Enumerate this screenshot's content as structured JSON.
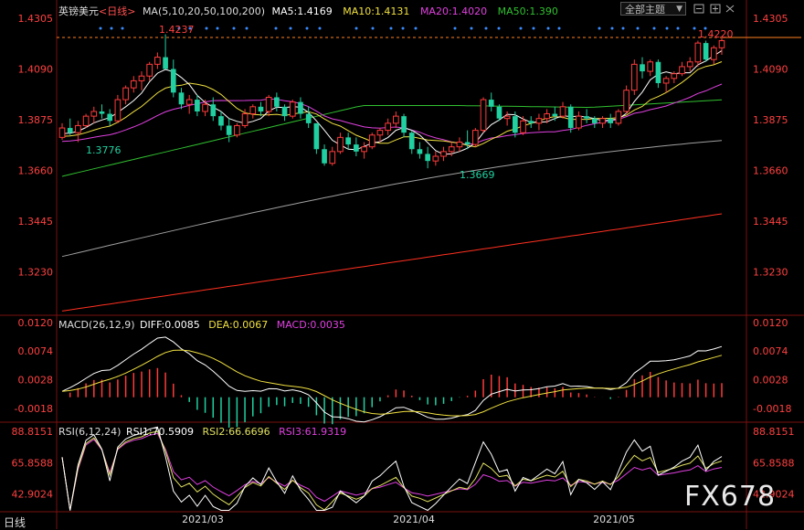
{
  "header": {
    "symbol": "英镑美元",
    "period": "<日线>",
    "ma_label": "MA(5,10,20,50,100,200)",
    "ma5": "MA5:1.4169",
    "ma10": "MA10:1.4131",
    "ma20": "MA20:1.4020",
    "ma50": "MA50:1.390",
    "theme_button": "全部主题",
    "period_tab": "日线"
  },
  "watermark": "FX678",
  "colors": {
    "up": "#ff3b3b",
    "down": "#20d0a0",
    "ma5": "#ffffff",
    "ma10": "#f0e040",
    "ma20": "#e040e0",
    "ma50": "#30c030",
    "ma100": "#a0a0a0",
    "ma200": "#ff3020",
    "price_axis": "#ff4040",
    "macd_axis": "#ff4040",
    "rsi1": "#ffffff",
    "rsi2": "#e0e060",
    "rsi3": "#e040e0"
  },
  "chart_data": [
    {
      "type": "candlestick",
      "title": "英镑美元<日线>",
      "ylim": [
        1.3046,
        1.4305
      ],
      "y_ticks": [
        "1.4305",
        "1.4090",
        "1.3875",
        "1.3660",
        "1.3445",
        "1.3230"
      ],
      "x_ticks": [
        "2021/03",
        "2021/04",
        "2021/05"
      ],
      "annotations": {
        "high": "1.4237",
        "low1": "1.3776",
        "low2": "1.3669",
        "last_high": "1.4220",
        "ma5": "1.4169",
        "ma10": "1.4131",
        "ma20": "1.4020",
        "ma50": "1.390"
      },
      "ohlc": [
        [
          1.38,
          1.386,
          1.379,
          1.384
        ],
        [
          1.384,
          1.388,
          1.381,
          1.382
        ],
        [
          1.382,
          1.387,
          1.378,
          1.385
        ],
        [
          1.385,
          1.39,
          1.384,
          1.389
        ],
        [
          1.389,
          1.393,
          1.386,
          1.391
        ],
        [
          1.391,
          1.394,
          1.388,
          1.39
        ],
        [
          1.39,
          1.392,
          1.385,
          1.387
        ],
        [
          1.387,
          1.398,
          1.386,
          1.396
        ],
        [
          1.396,
          1.402,
          1.394,
          1.401
        ],
        [
          1.401,
          1.406,
          1.399,
          1.404
        ],
        [
          1.404,
          1.408,
          1.4,
          1.406
        ],
        [
          1.406,
          1.412,
          1.404,
          1.411
        ],
        [
          1.411,
          1.416,
          1.409,
          1.414
        ],
        [
          1.414,
          1.4237,
          1.41,
          1.409
        ],
        [
          1.409,
          1.413,
          1.397,
          1.399
        ],
        [
          1.399,
          1.401,
          1.392,
          1.394
        ],
        [
          1.394,
          1.398,
          1.39,
          1.396
        ],
        [
          1.396,
          1.398,
          1.389,
          1.391
        ],
        [
          1.391,
          1.396,
          1.389,
          1.394
        ],
        [
          1.394,
          1.397,
          1.387,
          1.389
        ],
        [
          1.389,
          1.391,
          1.383,
          1.385
        ],
        [
          1.385,
          1.388,
          1.378,
          1.381
        ],
        [
          1.381,
          1.386,
          1.38,
          1.385
        ],
        [
          1.385,
          1.392,
          1.384,
          1.39
        ],
        [
          1.39,
          1.394,
          1.388,
          1.393
        ],
        [
          1.393,
          1.395,
          1.389,
          1.391
        ],
        [
          1.391,
          1.398,
          1.389,
          1.397
        ],
        [
          1.397,
          1.399,
          1.391,
          1.393
        ],
        [
          1.393,
          1.394,
          1.387,
          1.389
        ],
        [
          1.389,
          1.396,
          1.388,
          1.395
        ],
        [
          1.395,
          1.397,
          1.388,
          1.39
        ],
        [
          1.39,
          1.393,
          1.384,
          1.386
        ],
        [
          1.386,
          1.386,
          1.373,
          1.375
        ],
        [
          1.375,
          1.377,
          1.368,
          1.369
        ],
        [
          1.369,
          1.376,
          1.368,
          1.374
        ],
        [
          1.374,
          1.382,
          1.373,
          1.38
        ],
        [
          1.38,
          1.382,
          1.375,
          1.377
        ],
        [
          1.377,
          1.38,
          1.372,
          1.374
        ],
        [
          1.374,
          1.378,
          1.371,
          1.376
        ],
        [
          1.376,
          1.382,
          1.375,
          1.381
        ],
        [
          1.381,
          1.384,
          1.378,
          1.383
        ],
        [
          1.383,
          1.388,
          1.381,
          1.386
        ],
        [
          1.386,
          1.391,
          1.384,
          1.389
        ],
        [
          1.389,
          1.39,
          1.38,
          1.382
        ],
        [
          1.382,
          1.383,
          1.373,
          1.375
        ],
        [
          1.375,
          1.378,
          1.371,
          1.373
        ],
        [
          1.373,
          1.376,
          1.3669,
          1.37
        ],
        [
          1.37,
          1.374,
          1.368,
          1.372
        ],
        [
          1.372,
          1.376,
          1.37,
          1.374
        ],
        [
          1.374,
          1.378,
          1.372,
          1.376
        ],
        [
          1.376,
          1.38,
          1.374,
          1.378
        ],
        [
          1.378,
          1.383,
          1.375,
          1.377
        ],
        [
          1.377,
          1.384,
          1.376,
          1.383
        ],
        [
          1.383,
          1.397,
          1.382,
          1.396
        ],
        [
          1.396,
          1.399,
          1.391,
          1.393
        ],
        [
          1.393,
          1.394,
          1.387,
          1.388
        ],
        [
          1.388,
          1.391,
          1.385,
          1.389
        ],
        [
          1.389,
          1.391,
          1.38,
          1.382
        ],
        [
          1.382,
          1.389,
          1.381,
          1.387
        ],
        [
          1.387,
          1.389,
          1.384,
          1.386
        ],
        [
          1.386,
          1.39,
          1.383,
          1.388
        ],
        [
          1.388,
          1.392,
          1.386,
          1.39
        ],
        [
          1.39,
          1.393,
          1.387,
          1.389
        ],
        [
          1.389,
          1.395,
          1.388,
          1.393
        ],
        [
          1.393,
          1.394,
          1.382,
          1.384
        ],
        [
          1.384,
          1.391,
          1.383,
          1.389
        ],
        [
          1.389,
          1.392,
          1.386,
          1.388
        ],
        [
          1.388,
          1.389,
          1.384,
          1.386
        ],
        [
          1.386,
          1.389,
          1.384,
          1.388
        ],
        [
          1.388,
          1.39,
          1.384,
          1.386
        ],
        [
          1.386,
          1.392,
          1.385,
          1.391
        ],
        [
          1.391,
          1.402,
          1.39,
          1.4
        ],
        [
          1.4,
          1.413,
          1.398,
          1.411
        ],
        [
          1.411,
          1.414,
          1.405,
          1.408
        ],
        [
          1.408,
          1.413,
          1.406,
          1.412
        ],
        [
          1.412,
          1.413,
          1.401,
          1.403
        ],
        [
          1.403,
          1.406,
          1.399,
          1.405
        ],
        [
          1.405,
          1.408,
          1.403,
          1.407
        ],
        [
          1.407,
          1.412,
          1.406,
          1.41
        ],
        [
          1.41,
          1.414,
          1.408,
          1.412
        ],
        [
          1.412,
          1.421,
          1.41,
          1.42
        ],
        [
          1.42,
          1.421,
          1.412,
          1.413
        ],
        [
          1.413,
          1.419,
          1.411,
          1.418
        ],
        [
          1.418,
          1.422,
          1.415,
          1.421
        ]
      ]
    },
    {
      "type": "line",
      "title": "MACD(26,12,9)",
      "series_labels": {
        "diff": "DIFF:0.0085",
        "dea": "DEA:0.0067",
        "macd": "MACD:0.0035"
      },
      "y_ticks": [
        "0.0120",
        "0.0074",
        "0.0028",
        "-0.0018"
      ],
      "ylim": [
        -0.004,
        0.013
      ]
    },
    {
      "type": "line",
      "title": "RSI(6,12,24)",
      "series_labels": {
        "rsi1": "RSI1:70.5909",
        "rsi2": "RSI2:66.6696",
        "rsi3": "RSI3:61.9319"
      },
      "y_ticks": [
        "88.8151",
        "65.8588",
        "42.9024"
      ],
      "ylim": [
        30,
        95
      ]
    }
  ]
}
